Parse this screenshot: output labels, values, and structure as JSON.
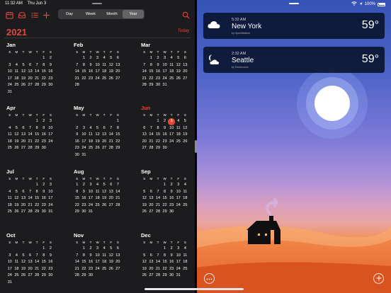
{
  "status": {
    "time": "11:32 AM",
    "date": "Thu Jun 3",
    "battery": "100%"
  },
  "toolbar": {
    "icons": [
      "calendar-icon",
      "inbox-icon",
      "list-icon",
      "plus-icon",
      "search-icon"
    ],
    "segments": [
      {
        "label": "Day",
        "active": false
      },
      {
        "label": "Week",
        "active": false
      },
      {
        "label": "Month",
        "active": false
      },
      {
        "label": "Year",
        "active": true
      }
    ]
  },
  "year": "2021",
  "today_label": "Today",
  "weekday_letters": [
    "S",
    "M",
    "T",
    "W",
    "T",
    "F",
    "S"
  ],
  "months": [
    {
      "name": "Jan",
      "offset": 5,
      "days": 31,
      "current": false
    },
    {
      "name": "Feb",
      "offset": 1,
      "days": 28,
      "current": false
    },
    {
      "name": "Mar",
      "offset": 1,
      "days": 31,
      "current": false
    },
    {
      "name": "Apr",
      "offset": 4,
      "days": 30,
      "current": false
    },
    {
      "name": "May",
      "offset": 6,
      "days": 31,
      "current": false
    },
    {
      "name": "Jun",
      "offset": 2,
      "days": 30,
      "current": true,
      "today": 3
    },
    {
      "name": "Jul",
      "offset": 4,
      "days": 31,
      "current": false
    },
    {
      "name": "Aug",
      "offset": 0,
      "days": 31,
      "current": false
    },
    {
      "name": "Sep",
      "offset": 3,
      "days": 30,
      "current": false
    },
    {
      "name": "Oct",
      "offset": 5,
      "days": 31,
      "current": false
    },
    {
      "name": "Nov",
      "offset": 1,
      "days": 30,
      "current": false
    },
    {
      "name": "Dec",
      "offset": 3,
      "days": 31,
      "current": false
    }
  ],
  "weather": [
    {
      "time": "5:32 AM",
      "city": "New York",
      "source": "by OpenWeather",
      "temp": "59°",
      "icon": "cloud-icon"
    },
    {
      "time": "2:32 AM",
      "city": "Seattle",
      "source": "by Tomorrow.io",
      "temp": "59°",
      "icon": "moon-cloud-icon"
    }
  ],
  "colors": {
    "accent_red": "#e2473b",
    "pane_dark": "#1c1c1e",
    "card_bg": "#08122a"
  }
}
